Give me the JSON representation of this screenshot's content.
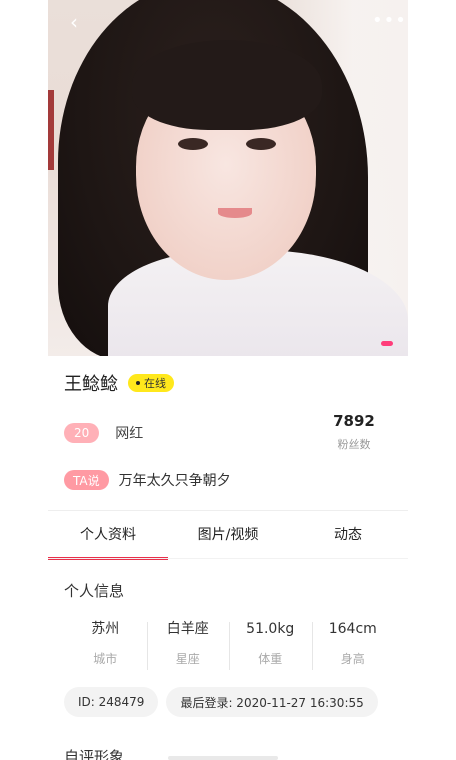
{
  "profile": {
    "name": "王鲶鲶",
    "status": "在线",
    "age": "20",
    "occupation": "网红",
    "fans_count": "7892",
    "fans_label": "粉丝数",
    "ta_label": "TA说",
    "signature": "万年太久只争朝夕"
  },
  "top_bar": {
    "back_icon": "chevron-left-icon",
    "more_icon": "more-dots-icon",
    "back_glyph": "‹",
    "more_glyph": "•••"
  },
  "tabs": [
    {
      "label": "个人资料",
      "active": true
    },
    {
      "label": "图片/视频",
      "active": false
    },
    {
      "label": "动态",
      "active": false
    }
  ],
  "personal_info": {
    "title": "个人信息",
    "stats": [
      {
        "value": "苏州",
        "label": "城市"
      },
      {
        "value": "白羊座",
        "label": "星座"
      },
      {
        "value": "51.0kg",
        "label": "体重"
      },
      {
        "value": "164cm",
        "label": "身高"
      }
    ],
    "id_chip": "ID: 248479",
    "last_login_chip": "最后登录: 2020-11-27 16:30:55"
  },
  "next_section_title": "自评形象",
  "colors": {
    "accent": "#e8304a",
    "online_badge": "#ffe81c",
    "age_badge": "#ffb0b7",
    "ta_badge": "#ff9aa3",
    "photo_indicator": "#ff3d7a"
  }
}
